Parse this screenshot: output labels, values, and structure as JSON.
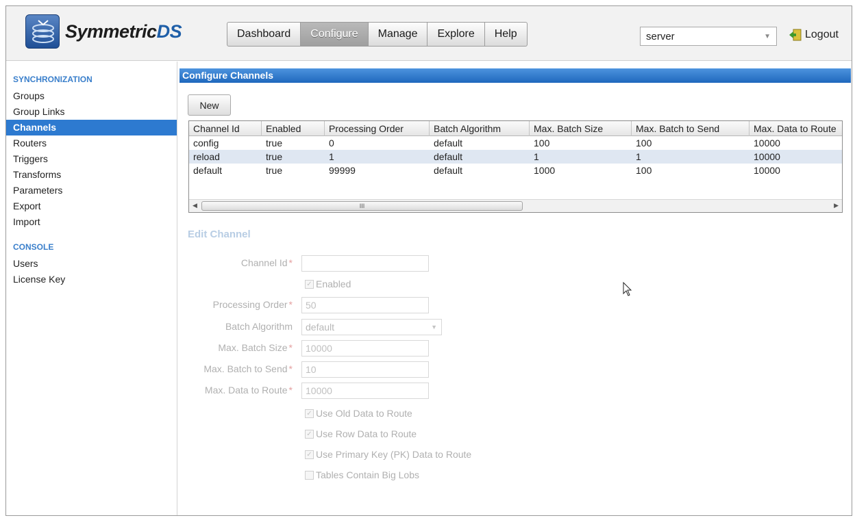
{
  "app": {
    "logo_part1": "Symmetric",
    "logo_part2": "DS"
  },
  "nav": {
    "items": [
      "Dashboard",
      "Configure",
      "Manage",
      "Explore",
      "Help"
    ],
    "active": "Configure"
  },
  "header": {
    "server_value": "server",
    "logout_label": "Logout"
  },
  "sidebar": {
    "section1": "SYNCHRONIZATION",
    "items1": [
      "Groups",
      "Group Links",
      "Channels",
      "Routers",
      "Triggers",
      "Transforms",
      "Parameters",
      "Export",
      "Import"
    ],
    "active": "Channels",
    "section2": "CONSOLE",
    "items2": [
      "Users",
      "License Key"
    ]
  },
  "main": {
    "panel_title": "Configure Channels",
    "new_button": "New",
    "table": {
      "columns": [
        "Channel Id",
        "Enabled",
        "Processing Order",
        "Batch Algorithm",
        "Max. Batch Size",
        "Max. Batch to Send",
        "Max. Data to Route"
      ],
      "rows": [
        [
          "config",
          "true",
          "0",
          "default",
          "100",
          "100",
          "10000"
        ],
        [
          "reload",
          "true",
          "1",
          "default",
          "1",
          "1",
          "10000"
        ],
        [
          "default",
          "true",
          "99999",
          "default",
          "1000",
          "100",
          "10000"
        ]
      ],
      "scroll_thumb_grip": "III"
    },
    "edit": {
      "title": "Edit Channel",
      "channel_id_label": "Channel Id",
      "channel_id_value": "",
      "enabled_label": "Enabled",
      "processing_order_label": "Processing Order",
      "processing_order_value": "50",
      "batch_algorithm_label": "Batch Algorithm",
      "batch_algorithm_value": "default",
      "max_batch_size_label": "Max. Batch Size",
      "max_batch_size_value": "10000",
      "max_batch_to_send_label": "Max. Batch to Send",
      "max_batch_to_send_value": "10",
      "max_data_to_route_label": "Max. Data to Route",
      "max_data_to_route_value": "10000",
      "use_old_data_label": "Use Old Data to Route",
      "use_row_data_label": "Use Row Data to Route",
      "use_pk_data_label": "Use Primary Key (PK) Data to Route",
      "big_lobs_label": "Tables Contain Big Lobs",
      "required_marker": "*"
    }
  },
  "colors": {
    "accent": "#2d7ad0",
    "panel_header": "#3a80d2",
    "alt_row": "#dfe7f2"
  }
}
